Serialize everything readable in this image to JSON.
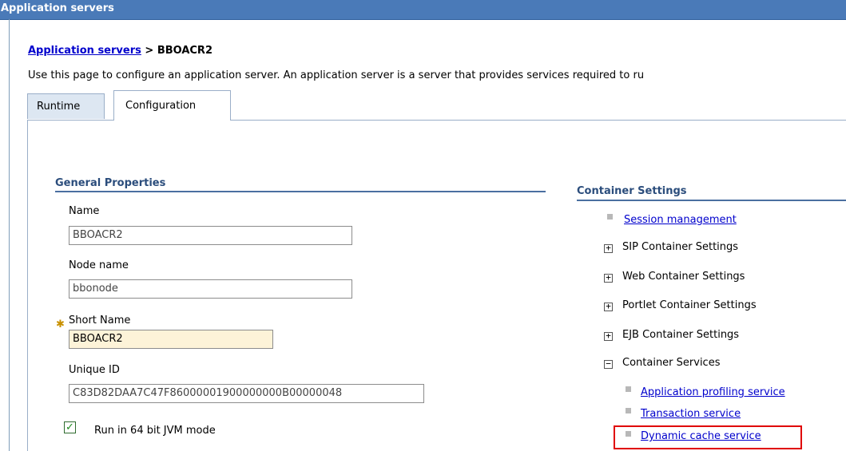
{
  "window": {
    "title": "Application servers"
  },
  "breadcrumb": {
    "link": "Application servers",
    "separator": " > ",
    "current": "BBOACR2"
  },
  "description": "Use this page to configure an application server. An application server is a server that provides services required to ru",
  "tabs": {
    "runtime": "Runtime",
    "configuration": "Configuration"
  },
  "general_properties": {
    "heading": "General Properties",
    "name_label": "Name",
    "name_value": "BBOACR2",
    "node_label": "Node name",
    "node_value": "bbonode",
    "short_name_label": "Short Name",
    "short_name_value": "BBOACR2",
    "unique_id_label": "Unique ID",
    "unique_id_value": "C83D82DAA7C47F86000001900000000B00000048",
    "run64_label": "Run in 64 bit JVM mode"
  },
  "container_settings": {
    "heading": "Container Settings",
    "session_management": "Session management",
    "sip": "SIP Container Settings",
    "web": "Web Container Settings",
    "portlet": "Portlet Container Settings",
    "ejb": "EJB Container Settings",
    "container_services": "Container Services",
    "app_profiling": "Application profiling service",
    "transaction": "Transaction service",
    "dynamic_cache": "Dynamic cache service"
  },
  "glyphs": {
    "required": "✱",
    "checked": "✓",
    "plus": "+",
    "minus": "−"
  },
  "colors": {
    "title_bar": "#4a7ab8",
    "link": "#0000cc",
    "highlight": "#e00000",
    "required_field": "#fdf3d8"
  }
}
